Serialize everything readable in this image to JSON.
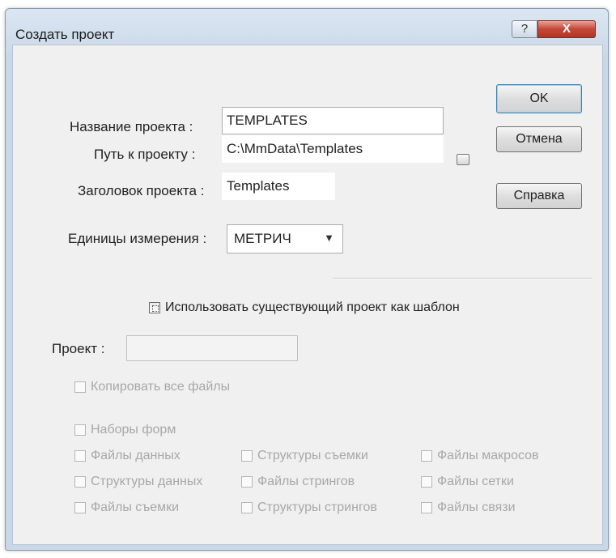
{
  "window": {
    "title": "Создать проект"
  },
  "title_buttons": {
    "help_glyph": "?",
    "close_glyph": "X"
  },
  "form": {
    "name_label": "Название проекта :",
    "name_value": "TEMPLATES",
    "path_label": "Путь к проекту :",
    "path_value": "C:\\MmData\\Templates",
    "heading_label": "Заголовок проекта :",
    "heading_value": "Templates",
    "units_label": "Единицы измерения :",
    "units_value": "МЕТРИЧ"
  },
  "buttons": {
    "ok": "OK",
    "cancel": "Отмена",
    "help": "Справка"
  },
  "template": {
    "use_existing_label": "Использовать существующий проект как шаблон",
    "project_label": "Проект :",
    "project_value": "",
    "copy_all_label": "Копировать все файлы",
    "form_sets_label": "Наборы форм",
    "files": [
      "Файлы данных",
      "Структуры съемки",
      "Файлы макросов",
      "Структуры данных",
      "Файлы стрингов",
      "Файлы сетки",
      "Файлы съемки",
      "Структуры стрингов",
      "Файлы связи"
    ]
  },
  "icons": {
    "dropdown": "chevron-down-icon",
    "browse": "browse-icon"
  }
}
